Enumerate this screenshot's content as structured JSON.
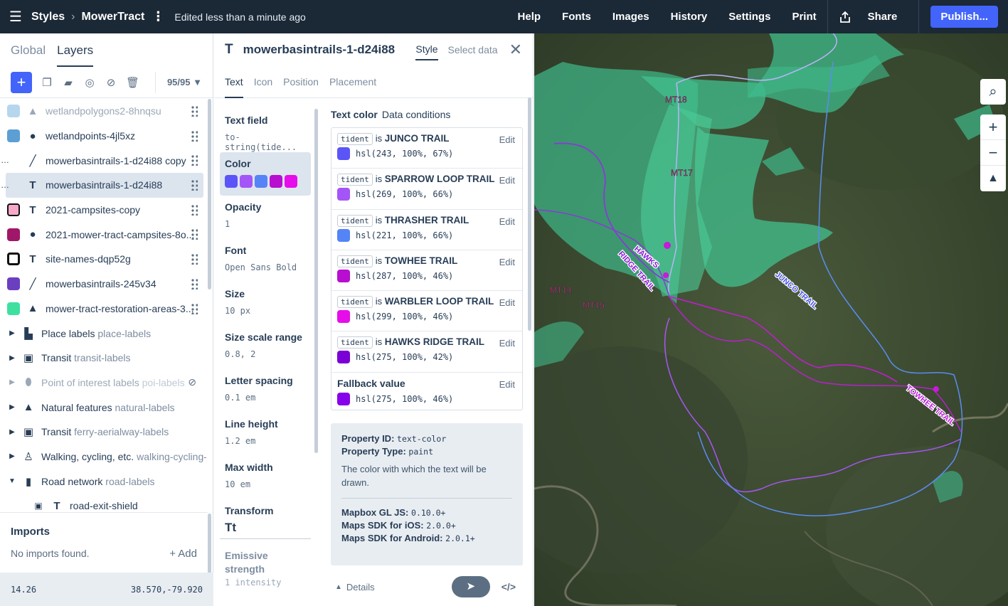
{
  "topbar": {
    "breadcrumb_root": "Styles",
    "breadcrumb_style": "MowerTract",
    "edited": "Edited less than a minute ago",
    "nav": [
      "Help",
      "Fonts",
      "Images",
      "History",
      "Settings",
      "Print"
    ],
    "share": "Share",
    "publish": "Publish..."
  },
  "left": {
    "tab_global": "Global",
    "tab_layers": "Layers",
    "layer_count": "95/95",
    "layers": [
      {
        "name": "wetlandpolygons2-8hnqsu",
        "swatch": "#a8d0ea",
        "icon": "polygon-icon",
        "dim": true
      },
      {
        "name": "wetlandpoints-4jl5xz",
        "swatch": "#5b9fd4",
        "icon": "circle-icon"
      },
      {
        "name": "mowerbasintrails-1-d24i88 copy",
        "swatch": "",
        "icon": "line-icon"
      },
      {
        "name": "mowerbasintrails-1-d24i88",
        "swatch": "",
        "icon": "text-icon",
        "selected": true
      },
      {
        "name": "2021-campsites-copy",
        "swatch": "#f7a8c8",
        "icon": "text-icon"
      },
      {
        "name": "2021-mower-tract-campsites-8o...",
        "swatch": "#a0176a",
        "icon": "circle-icon"
      },
      {
        "name": "site-names-dqp52g",
        "swatch": "#ffffff",
        "icon": "text-icon"
      },
      {
        "name": "mowerbasintrails-245v34",
        "swatch": "#6a3fc0",
        "icon": "line-icon"
      },
      {
        "name": "mower-tract-restoration-areas-3...",
        "swatch": "#3ee0a0",
        "icon": "polygon-icon"
      }
    ],
    "groups": [
      {
        "name": "Place labels",
        "sub": "place-labels",
        "icon": "buildings-icon"
      },
      {
        "name": "Transit",
        "sub": "transit-labels",
        "icon": "train-icon"
      },
      {
        "name": "Point of interest labels",
        "sub": "poi-labels",
        "icon": "pin-icon",
        "hidden": true
      },
      {
        "name": "Natural features",
        "sub": "natural-labels",
        "icon": "mountain-icon"
      },
      {
        "name": "Transit",
        "sub": "ferry-aerialway-labels",
        "icon": "train-icon"
      },
      {
        "name": "Walking, cycling, etc.",
        "sub": "walking-cycling-l",
        "icon": "walker-icon"
      },
      {
        "name": "Road network",
        "sub": "road-labels",
        "icon": "road-icon",
        "open": true
      }
    ],
    "child": "road-exit-shield",
    "imports_title": "Imports",
    "imports_empty": "No imports found.",
    "imports_add": "+ Add",
    "zoom": "14.26",
    "coords": "38.570,-79.920"
  },
  "editor": {
    "layer_name": "mowerbasintrails-1-d24i88",
    "tab_style": "Style",
    "tab_select": "Select data",
    "subtabs": [
      "Text",
      "Icon",
      "Position",
      "Placement"
    ],
    "props": [
      {
        "label": "Text field",
        "value": "to-string(tide..."
      },
      {
        "label": "Color",
        "value": ""
      },
      {
        "label": "Opacity",
        "value": "1"
      },
      {
        "label": "Font",
        "value": "Open Sans Bold"
      },
      {
        "label": "Size",
        "value": "10 px"
      },
      {
        "label": "Size scale range",
        "value": "0.8, 2"
      },
      {
        "label": "Letter spacing",
        "value": "0.1 em"
      },
      {
        "label": "Line height",
        "value": "1.2 em"
      },
      {
        "label": "Max width",
        "value": "10 em"
      },
      {
        "label": "Transform",
        "value": "Tt"
      },
      {
        "label": "Emissive strength",
        "value": "1 intensity"
      }
    ],
    "color_chips": [
      "#5b55f8",
      "#a455f8",
      "#5584f6",
      "#b80ed0",
      "#e60dea"
    ],
    "cond_title": "Text color",
    "cond_sub": "Data conditions",
    "conditions": [
      {
        "field": "tident",
        "op": "is",
        "value": "JUNCO TRAIL",
        "color": "hsl(243, 100%, 67%)",
        "hex": "#5b55f8"
      },
      {
        "field": "tident",
        "op": "is",
        "value": "SPARROW LOOP TRAIL",
        "color": "hsl(269, 100%, 66%)",
        "hex": "#a455f8"
      },
      {
        "field": "tident",
        "op": "is",
        "value": "THRASHER TRAIL",
        "color": "hsl(221, 100%, 66%)",
        "hex": "#5584f6"
      },
      {
        "field": "tident",
        "op": "is",
        "value": "TOWHEE TRAIL",
        "color": "hsl(287, 100%, 46%)",
        "hex": "#b80ed0"
      },
      {
        "field": "tident",
        "op": "is",
        "value": "WARBLER LOOP TRAIL",
        "color": "hsl(299, 100%, 46%)",
        "hex": "#e60dea"
      },
      {
        "field": "tident",
        "op": "is",
        "value": "HAWKS RIDGE TRAIL",
        "color": "hsl(275, 100%, 42%)",
        "hex": "#7b00d6"
      }
    ],
    "edit_label": "Edit",
    "fallback_label": "Fallback value",
    "fallback_color": "hsl(275, 100%, 46%)",
    "fallback_hex": "#8700eb",
    "info": {
      "prop_id_label": "Property ID:",
      "prop_id": "text-color",
      "prop_type_label": "Property Type:",
      "prop_type": "paint",
      "desc": "The color with which the text will be drawn.",
      "sdk": [
        {
          "label": "Mapbox GL JS:",
          "ver": "0.10.0+"
        },
        {
          "label": "Maps SDK for iOS:",
          "ver": "2.0.0+"
        },
        {
          "label": "Maps SDK for Android:",
          "ver": "2.0.1+"
        }
      ]
    },
    "details": "Details"
  },
  "map": {
    "labels": [
      "MT18",
      "MT17",
      "MT14",
      "MT15",
      "HAWKS",
      "RIDGE TRAIL",
      "JUNCO TRAIL",
      "TOWHEE TRAIL"
    ]
  },
  "colors": {
    "accent": "#4264fb",
    "topbar": "#1b2836"
  }
}
